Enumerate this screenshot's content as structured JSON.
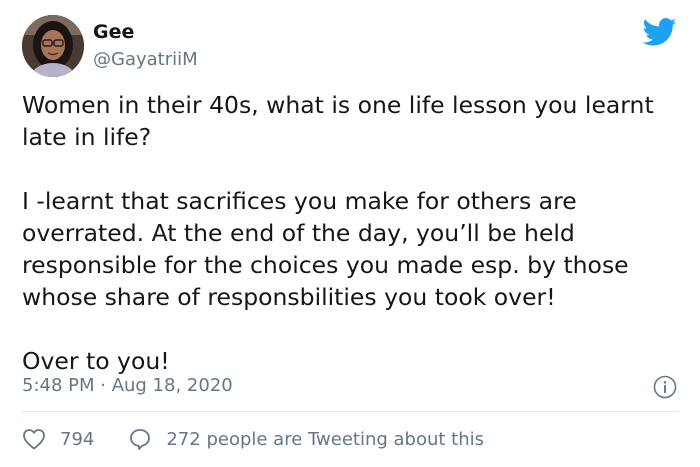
{
  "user": {
    "name": "Gee",
    "handle": "@GayatriiM",
    "avatar_icon": "profile-photo-avatar"
  },
  "brand": {
    "logo_icon": "twitter-bird-icon",
    "color": "#1da1f2"
  },
  "tweet": {
    "paragraphs": [
      "Women in their 40s, what is one life lesson you learnt\nlate in life?",
      "I -learnt that sacrifices you make for others are\noverrated. At the end of the day, you’ll be held\nresponsible for the choices you made esp. by those\nwhose share of responsbilities you took over!",
      "Over to you!"
    ],
    "timestamp": "5:48 PM · Aug 18, 2020"
  },
  "actions": {
    "like_icon": "heart-icon",
    "like_count": "794",
    "reply_icon": "speech-bubble-icon",
    "reply_text": "272 people are Tweeting about this",
    "info_icon": "info-icon"
  }
}
